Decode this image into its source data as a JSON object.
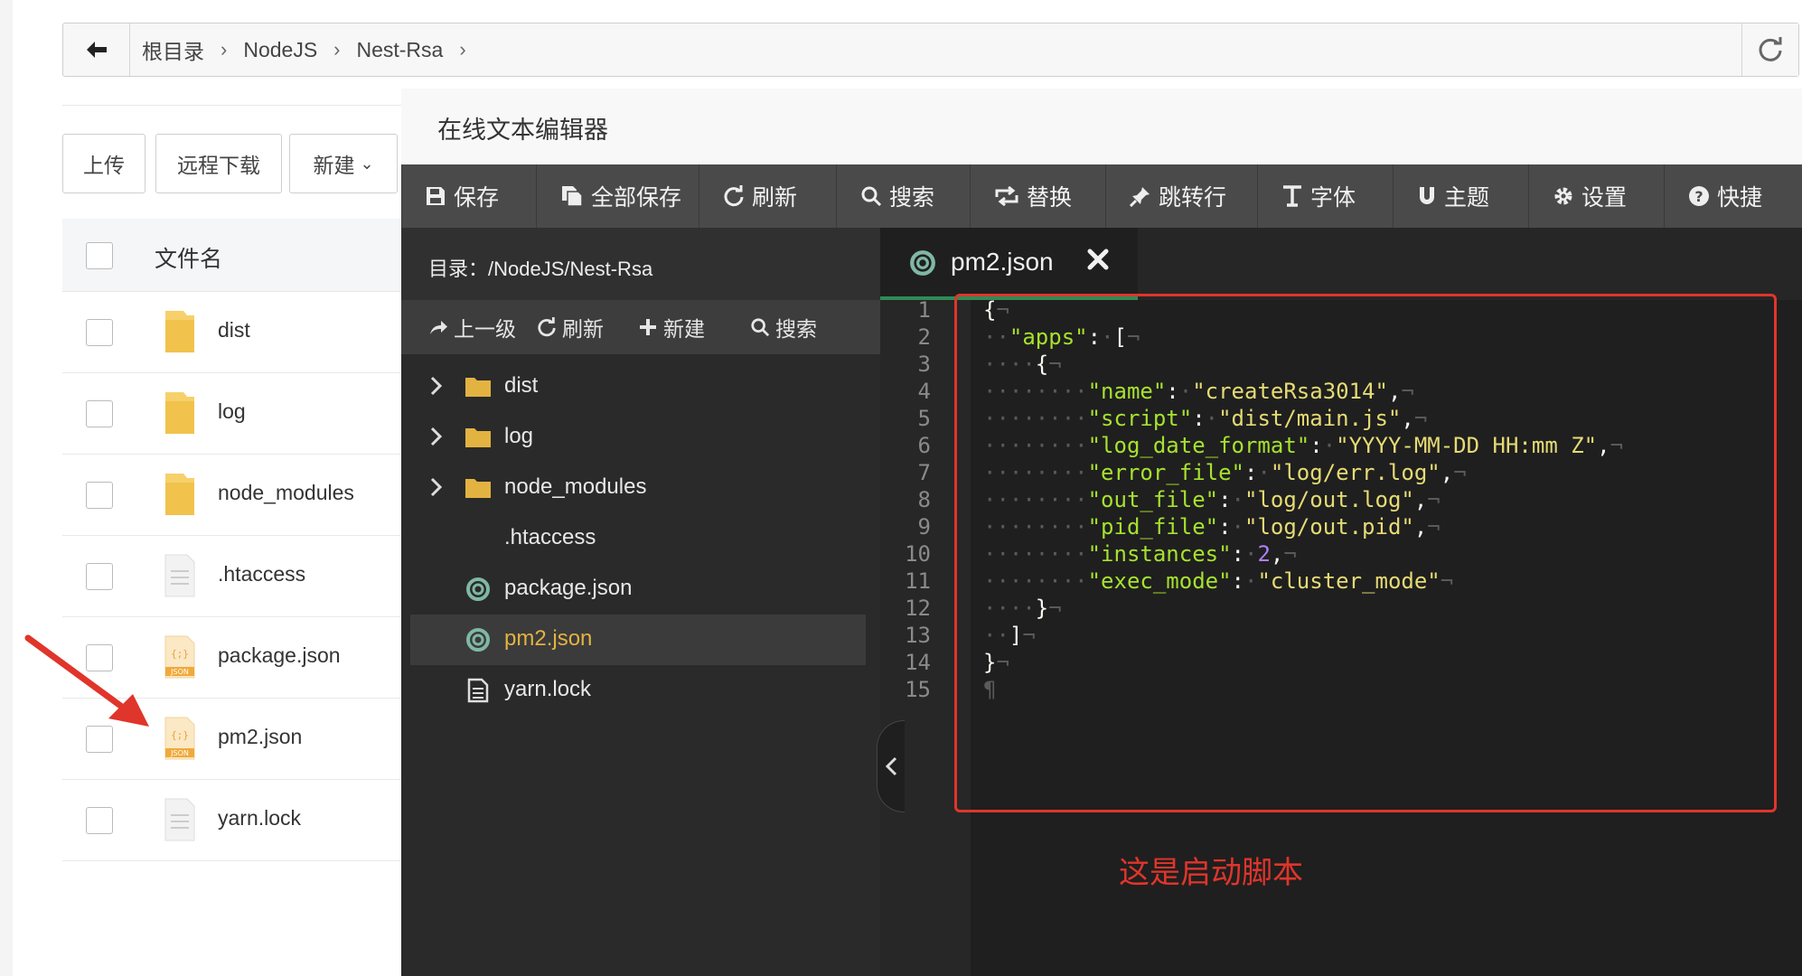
{
  "breadcrumb": {
    "items": [
      "根目录",
      "NodeJS",
      "Nest-Rsa"
    ]
  },
  "file_manager": {
    "buttons": {
      "upload": "上传",
      "remote_download": "远程下载",
      "new": "新建"
    },
    "header": "文件名",
    "files": [
      {
        "name": "dist",
        "type": "folder"
      },
      {
        "name": "log",
        "type": "folder"
      },
      {
        "name": "node_modules",
        "type": "folder"
      },
      {
        "name": ".htaccess",
        "type": "file"
      },
      {
        "name": "package.json",
        "type": "json"
      },
      {
        "name": "pm2.json",
        "type": "json"
      },
      {
        "name": "yarn.lock",
        "type": "file"
      }
    ],
    "json_icon_label": "JSON"
  },
  "editor": {
    "title": "在线文本编辑器",
    "toolbar": [
      {
        "label": "保存",
        "icon": "save-icon"
      },
      {
        "label": "全部保存",
        "icon": "save-all-icon"
      },
      {
        "label": "刷新",
        "icon": "refresh-icon"
      },
      {
        "label": "搜索",
        "icon": "search-icon"
      },
      {
        "label": "替换",
        "icon": "replace-icon"
      },
      {
        "label": "跳转行",
        "icon": "pin-icon"
      },
      {
        "label": "字体",
        "icon": "font-icon"
      },
      {
        "label": "主题",
        "icon": "magnet-icon"
      },
      {
        "label": "设置",
        "icon": "gear-icon"
      },
      {
        "label": "快捷",
        "icon": "help-icon"
      }
    ],
    "tree": {
      "dir_label": "目录：/NodeJS/Nest-Rsa",
      "actions": {
        "up": "上一级",
        "refresh": "刷新",
        "new": "新建",
        "search": "搜索"
      },
      "items": [
        {
          "name": "dist",
          "type": "folder"
        },
        {
          "name": "log",
          "type": "folder"
        },
        {
          "name": "node_modules",
          "type": "folder"
        },
        {
          "name": ".htaccess",
          "type": "plain"
        },
        {
          "name": "package.json",
          "type": "json"
        },
        {
          "name": "pm2.json",
          "type": "json",
          "selected": true
        },
        {
          "name": "yarn.lock",
          "type": "text"
        }
      ]
    },
    "tab": {
      "label": "pm2.json"
    },
    "code_lines": [
      [
        {
          "t": "p",
          "v": "{"
        },
        {
          "t": "ws",
          "v": "¬"
        }
      ],
      [
        {
          "t": "ws",
          "v": "··"
        },
        {
          "t": "k",
          "v": "\"apps\""
        },
        {
          "t": "p",
          "v": ":"
        },
        {
          "t": "ws",
          "v": "·"
        },
        {
          "t": "p",
          "v": "["
        },
        {
          "t": "ws",
          "v": "¬"
        }
      ],
      [
        {
          "t": "ws",
          "v": "····"
        },
        {
          "t": "p",
          "v": "{"
        },
        {
          "t": "ws",
          "v": "¬"
        }
      ],
      [
        {
          "t": "ws",
          "v": "········"
        },
        {
          "t": "k",
          "v": "\"name\""
        },
        {
          "t": "p",
          "v": ":"
        },
        {
          "t": "ws",
          "v": "·"
        },
        {
          "t": "s",
          "v": "\"createRsa3014\""
        },
        {
          "t": "p",
          "v": ","
        },
        {
          "t": "ws",
          "v": "¬"
        }
      ],
      [
        {
          "t": "ws",
          "v": "········"
        },
        {
          "t": "k",
          "v": "\"script\""
        },
        {
          "t": "p",
          "v": ":"
        },
        {
          "t": "ws",
          "v": "·"
        },
        {
          "t": "s",
          "v": "\"dist/main.js\""
        },
        {
          "t": "p",
          "v": ","
        },
        {
          "t": "ws",
          "v": "¬"
        }
      ],
      [
        {
          "t": "ws",
          "v": "········"
        },
        {
          "t": "k",
          "v": "\"log_date_format\""
        },
        {
          "t": "p",
          "v": ":"
        },
        {
          "t": "ws",
          "v": "·"
        },
        {
          "t": "s",
          "v": "\"YYYY-MM-DD HH:mm Z\""
        },
        {
          "t": "p",
          "v": ","
        },
        {
          "t": "ws",
          "v": "¬"
        }
      ],
      [
        {
          "t": "ws",
          "v": "········"
        },
        {
          "t": "k",
          "v": "\"error_file\""
        },
        {
          "t": "p",
          "v": ":"
        },
        {
          "t": "ws",
          "v": "·"
        },
        {
          "t": "s",
          "v": "\"log/err.log\""
        },
        {
          "t": "p",
          "v": ","
        },
        {
          "t": "ws",
          "v": "¬"
        }
      ],
      [
        {
          "t": "ws",
          "v": "········"
        },
        {
          "t": "k",
          "v": "\"out_file\""
        },
        {
          "t": "p",
          "v": ":"
        },
        {
          "t": "ws",
          "v": "·"
        },
        {
          "t": "s",
          "v": "\"log/out.log\""
        },
        {
          "t": "p",
          "v": ","
        },
        {
          "t": "ws",
          "v": "¬"
        }
      ],
      [
        {
          "t": "ws",
          "v": "········"
        },
        {
          "t": "k",
          "v": "\"pid_file\""
        },
        {
          "t": "p",
          "v": ":"
        },
        {
          "t": "ws",
          "v": "·"
        },
        {
          "t": "s",
          "v": "\"log/out.pid\""
        },
        {
          "t": "p",
          "v": ","
        },
        {
          "t": "ws",
          "v": "¬"
        }
      ],
      [
        {
          "t": "ws",
          "v": "········"
        },
        {
          "t": "k",
          "v": "\"instances\""
        },
        {
          "t": "p",
          "v": ":"
        },
        {
          "t": "ws",
          "v": "·"
        },
        {
          "t": "n",
          "v": "2"
        },
        {
          "t": "p",
          "v": ","
        },
        {
          "t": "ws",
          "v": "¬"
        }
      ],
      [
        {
          "t": "ws",
          "v": "········"
        },
        {
          "t": "k",
          "v": "\"exec_mode\""
        },
        {
          "t": "p",
          "v": ":"
        },
        {
          "t": "ws",
          "v": "·"
        },
        {
          "t": "s",
          "v": "\"cluster_mode\""
        },
        {
          "t": "ws",
          "v": "¬"
        }
      ],
      [
        {
          "t": "ws",
          "v": "····"
        },
        {
          "t": "p",
          "v": "}"
        },
        {
          "t": "ws",
          "v": "¬"
        }
      ],
      [
        {
          "t": "ws",
          "v": "··"
        },
        {
          "t": "p",
          "v": "]"
        },
        {
          "t": "ws",
          "v": "¬"
        }
      ],
      [
        {
          "t": "p",
          "v": "}"
        },
        {
          "t": "ws",
          "v": "¬"
        }
      ],
      [
        {
          "t": "ws",
          "v": "¶"
        }
      ]
    ],
    "annotation": "这是启动脚本"
  },
  "colors": {
    "annotation": "#e0352b",
    "json_key": "#a6e22e",
    "json_string": "#e6db74",
    "json_number": "#ae81ff",
    "selected_file": "#e3b341"
  }
}
